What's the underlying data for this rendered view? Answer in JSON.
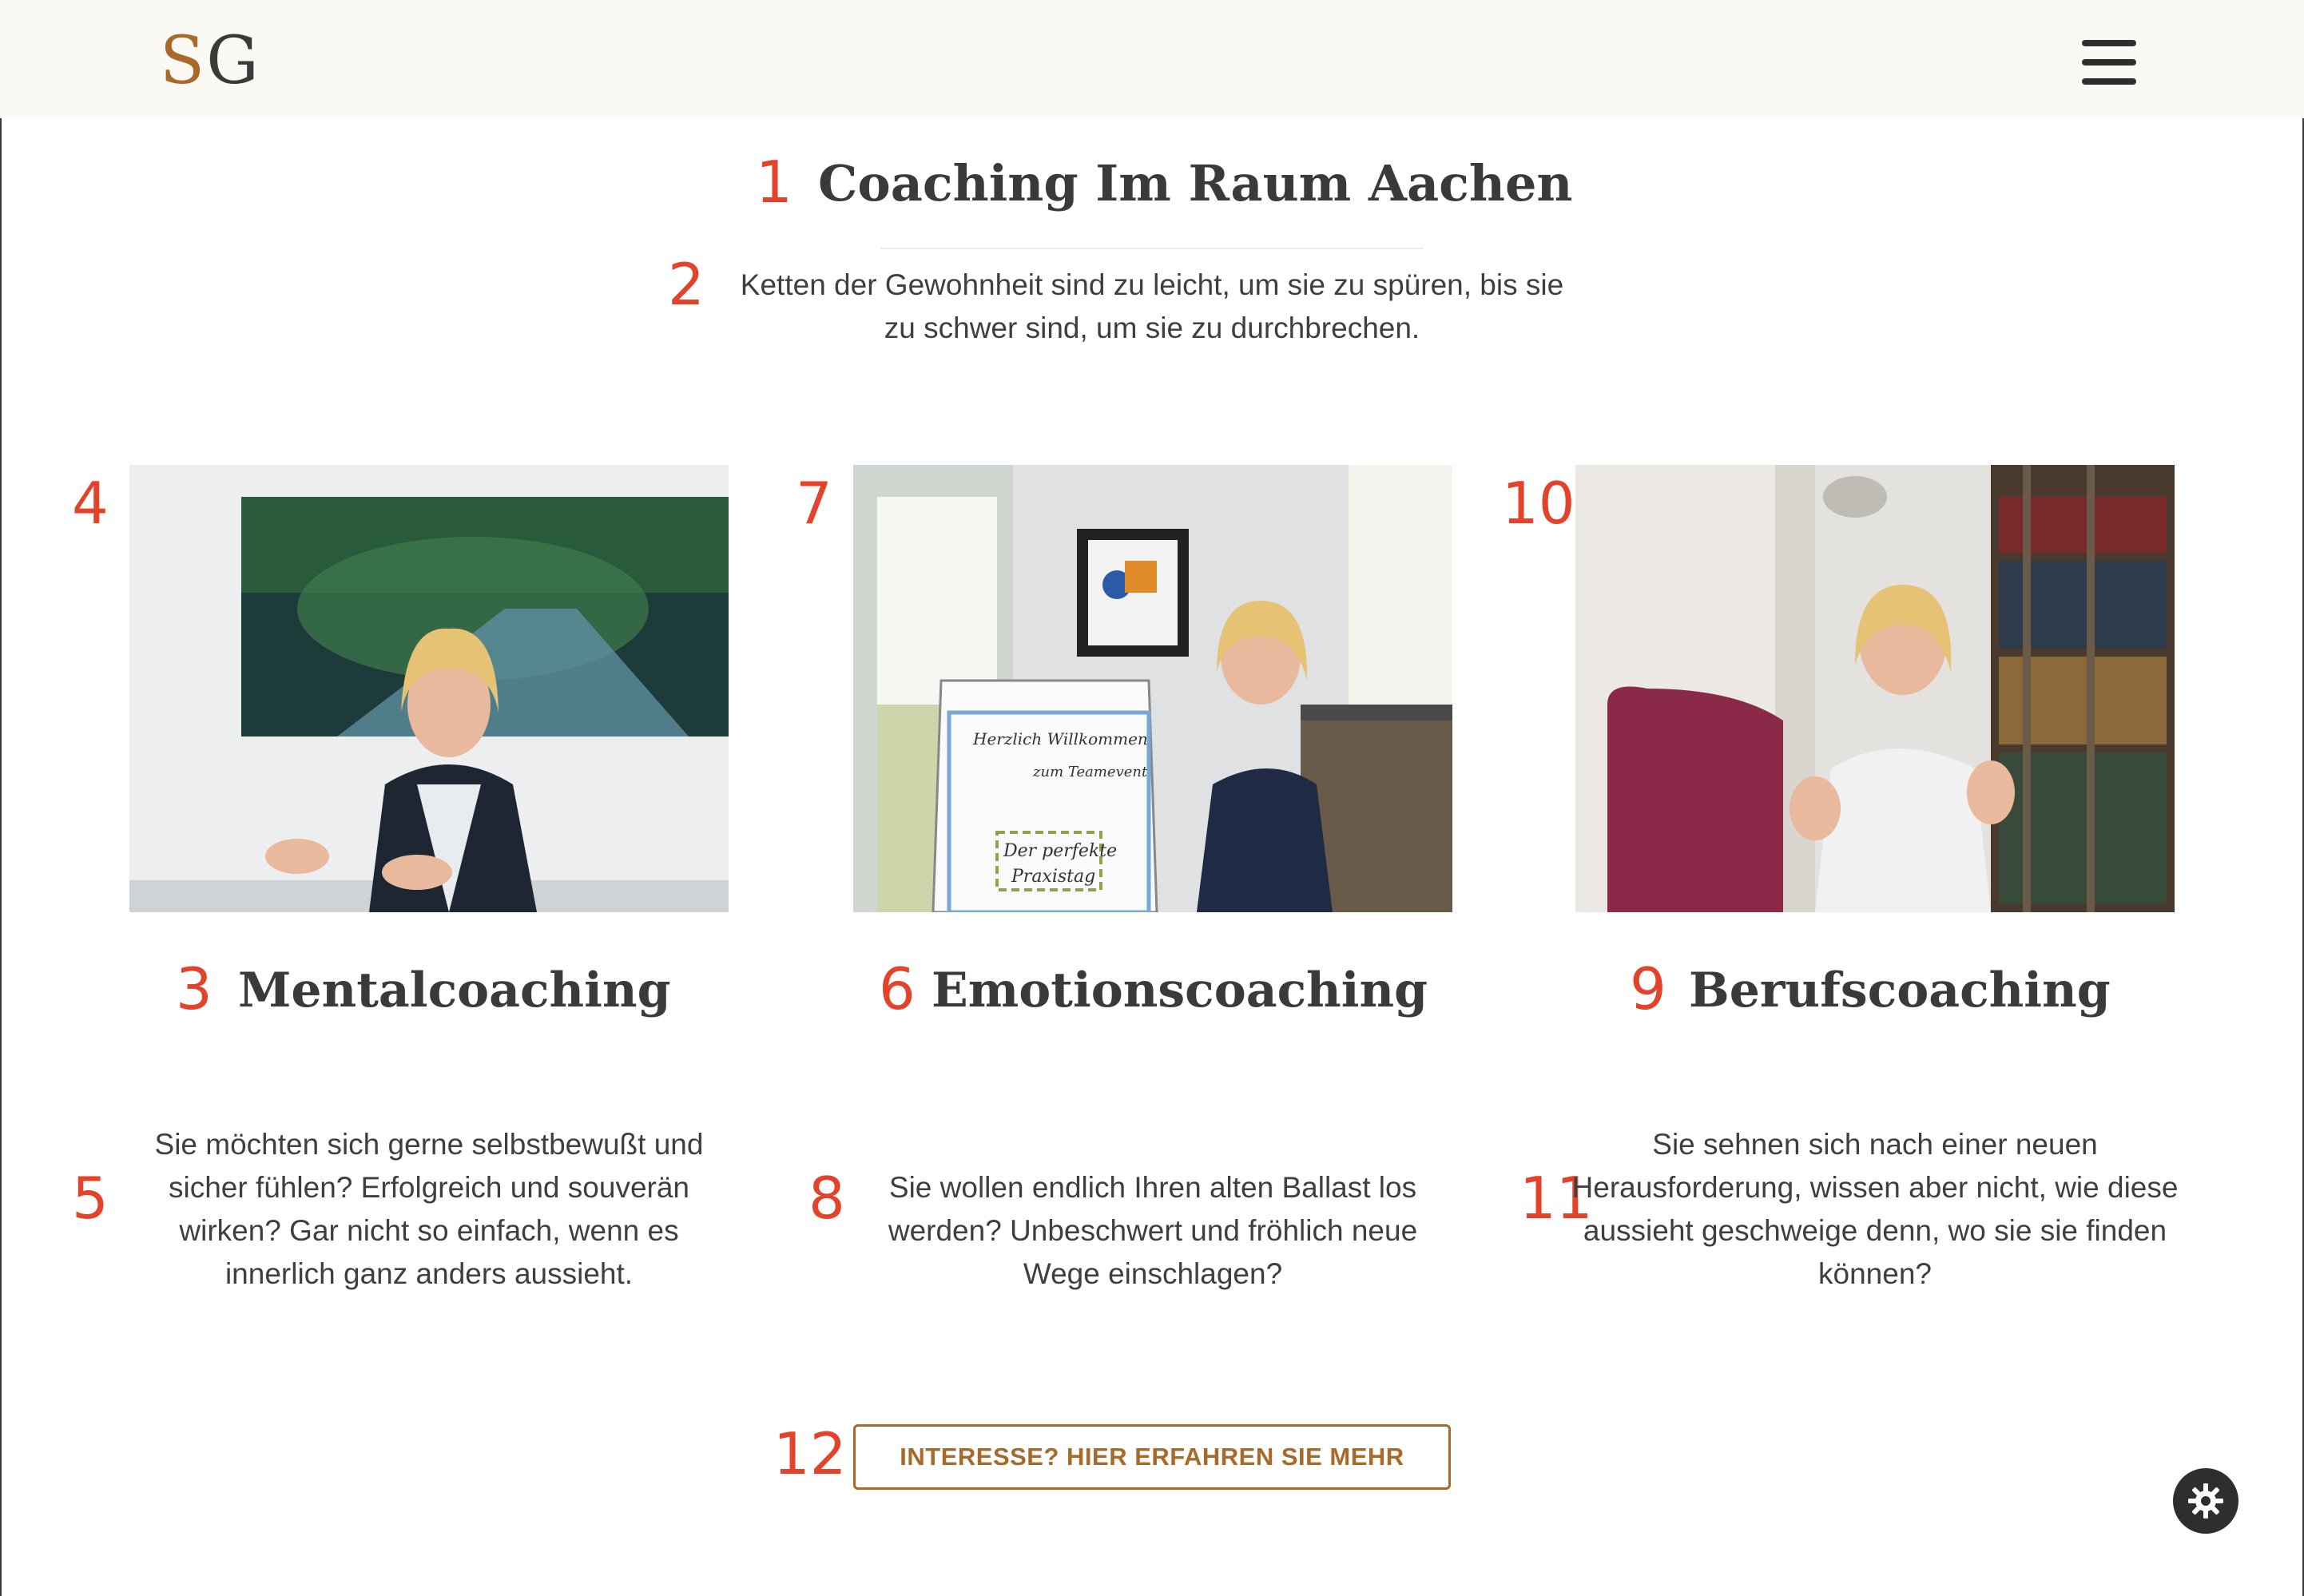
{
  "header": {
    "logo_s": "S",
    "logo_g": "G",
    "menu_icon": "hamburger-menu-icon"
  },
  "markers": [
    "1",
    "2",
    "3",
    "4",
    "5",
    "6",
    "7",
    "8",
    "9",
    "10",
    "11",
    "12"
  ],
  "main": {
    "title": "Coaching Im Raum Aachen",
    "quote": "Ketten der Gewohnheit sind zu leicht, um sie zu spüren, bis sie zu schwer sind, um sie zu durchbrechen."
  },
  "cards": [
    {
      "title": "Mentalcoaching",
      "text": "Sie möchten sich gerne selbstbewußt und sicher fühlen? Erfolgreich und souverän wirken? Gar nicht so einfach, wenn es innerlich ganz anders aussieht."
    },
    {
      "title": "Emotionscoaching",
      "text": "Sie wollen endlich Ihren alten Ballast los werden? Unbeschwert und fröhlich neue Wege einschlagen?",
      "flipchart_line1": "Herzlich Willkommen",
      "flipchart_line2": "zum Teamevent",
      "flipchart_line3": "Der perfekte",
      "flipchart_line4": "Praxistag"
    },
    {
      "title": "Berufscoaching",
      "text": "Sie sehnen sich nach einer neuen Herausforderung, wissen aber nicht, wie diese aussieht geschweige denn, wo sie sie finden können?"
    }
  ],
  "cta": {
    "label": "INTERESSE? HIER ERFAHREN SIE MEHR"
  },
  "settings": {
    "icon": "gear-icon"
  },
  "colors": {
    "accent": "#a8692a",
    "marker": "#e2432a",
    "header_bg": "#fbf9f4",
    "text": "#3f3f3f"
  }
}
